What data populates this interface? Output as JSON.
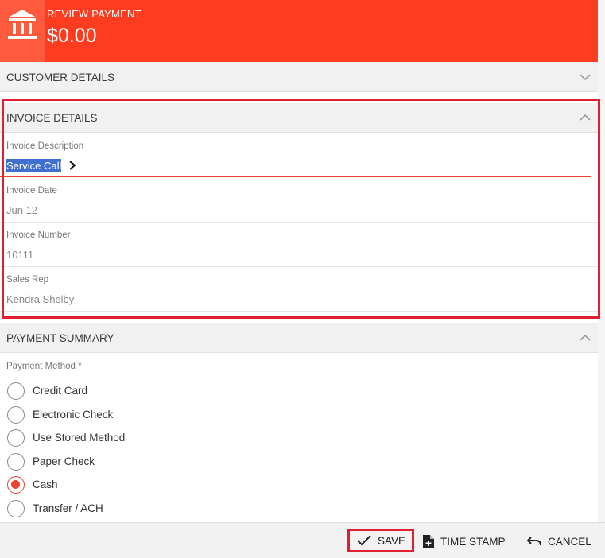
{
  "header": {
    "title": "REVIEW PAYMENT",
    "amount": "$0.00",
    "brand_color": "#fe3c1f",
    "logo_icon": "bank-icon"
  },
  "sections": {
    "customer_details": {
      "label": "CUSTOMER DETAILS",
      "state": "collapsed"
    },
    "invoice_details": {
      "label": "INVOICE DETAILS",
      "state": "expanded"
    },
    "payment_summary": {
      "label": "PAYMENT SUMMARY",
      "state": "expanded"
    }
  },
  "invoice": {
    "description": {
      "label": "Invoice Description",
      "value": "Service Call"
    },
    "date": {
      "label": "Invoice Date",
      "value": "Jun 12"
    },
    "number": {
      "label": "Invoice Number",
      "value": "10111"
    },
    "sales_rep": {
      "label": "Sales Rep",
      "value": "Kendra Shelby"
    }
  },
  "payment": {
    "method_label": "Payment Method *",
    "methods": [
      {
        "label": "Credit Card",
        "checked": false
      },
      {
        "label": "Electronic Check",
        "checked": false
      },
      {
        "label": "Use Stored Method",
        "checked": false
      },
      {
        "label": "Paper Check",
        "checked": false
      },
      {
        "label": "Cash",
        "checked": true
      },
      {
        "label": "Transfer / ACH",
        "checked": false
      }
    ]
  },
  "footer": {
    "save_label": "SAVE",
    "timestamp_label": "TIME STAMP",
    "cancel_label": "CANCEL"
  },
  "colors": {
    "accent": "#e8462f",
    "highlight": "#e02030",
    "selection": "#3f6fd0"
  }
}
